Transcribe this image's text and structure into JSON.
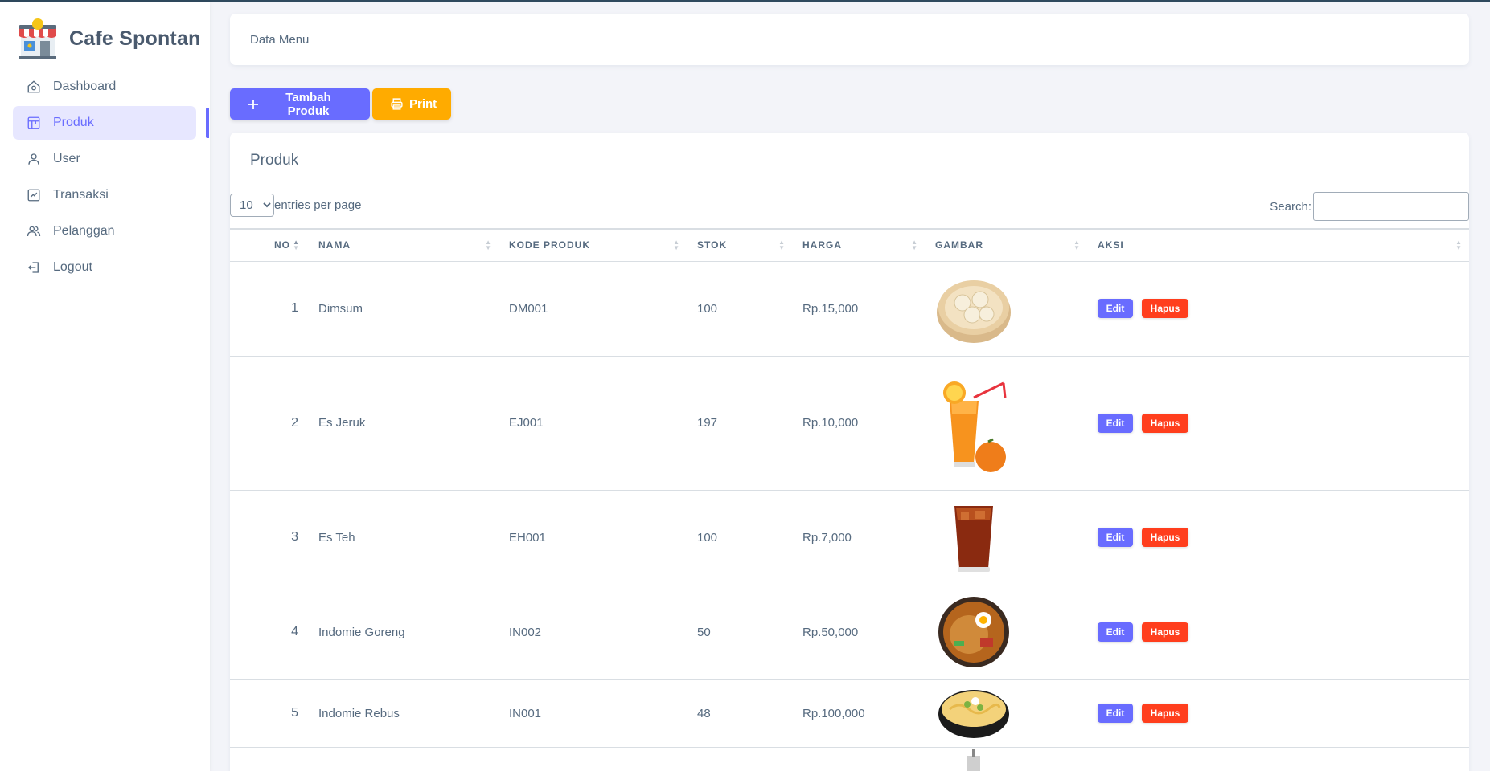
{
  "app": {
    "name": "Cafe Spontan"
  },
  "sidebar": {
    "items": [
      {
        "label": "Dashboard",
        "icon": "home-icon",
        "active": false
      },
      {
        "label": "Produk",
        "icon": "store-icon",
        "active": true
      },
      {
        "label": "User",
        "icon": "user-icon",
        "active": false
      },
      {
        "label": "Transaksi",
        "icon": "chart-icon",
        "active": false
      },
      {
        "label": "Pelanggan",
        "icon": "users-icon",
        "active": false
      },
      {
        "label": "Logout",
        "icon": "logout-icon",
        "active": false
      }
    ]
  },
  "header": {
    "title": "Data Menu"
  },
  "toolbar": {
    "add_label": "Tambah Produk",
    "print_label": "Print"
  },
  "table_card": {
    "title": "Produk",
    "entries_value": "10",
    "entries_label": "entries per page",
    "search_label": "Search:",
    "search_value": ""
  },
  "table": {
    "columns": [
      "NO",
      "NAMA",
      "KODE PRODUK",
      "STOK",
      "HARGA",
      "GAMBAR",
      "AKSI"
    ],
    "rows": [
      {
        "no": "1",
        "nama": "Dimsum",
        "kode": "DM001",
        "stok": "100",
        "harga": "Rp.15,000",
        "image": "dimsum-image"
      },
      {
        "no": "2",
        "nama": "Es Jeruk",
        "kode": "EJ001",
        "stok": "197",
        "harga": "Rp.10,000",
        "image": "orange-juice-image"
      },
      {
        "no": "3",
        "nama": "Es Teh",
        "kode": "EH001",
        "stok": "100",
        "harga": "Rp.7,000",
        "image": "iced-tea-image"
      },
      {
        "no": "4",
        "nama": "Indomie Goreng",
        "kode": "IN002",
        "stok": "50",
        "harga": "Rp.50,000",
        "image": "fried-noodle-image"
      },
      {
        "no": "5",
        "nama": "Indomie Rebus",
        "kode": "IN001",
        "stok": "48",
        "harga": "Rp.100,000",
        "image": "noodle-soup-image"
      }
    ],
    "edit_label": "Edit",
    "delete_label": "Hapus"
  },
  "colors": {
    "primary": "#696cff",
    "warning": "#ffab00",
    "danger": "#ff3e1d"
  }
}
